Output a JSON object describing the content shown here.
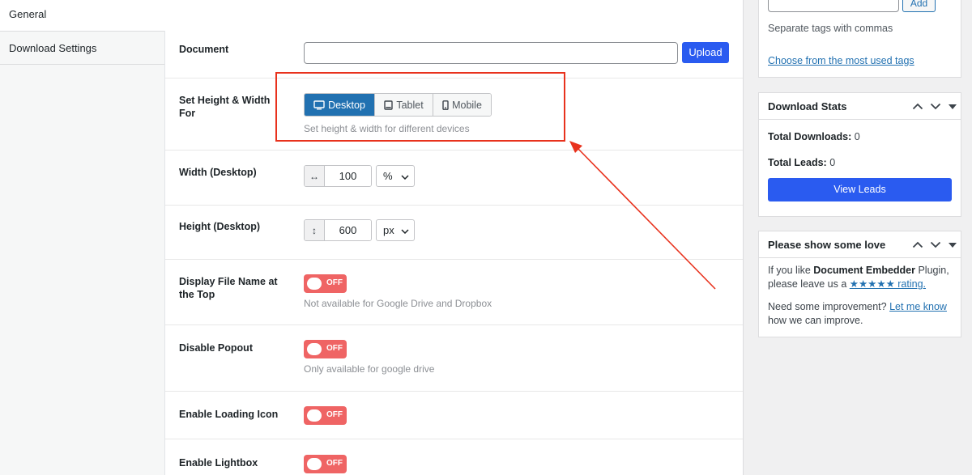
{
  "tabs": [
    {
      "label": "General"
    },
    {
      "label": "Download Settings"
    }
  ],
  "fields": {
    "document": {
      "label": "Document",
      "value": "",
      "upload_label": "Upload"
    },
    "devices": {
      "label": "Set Height & Width For",
      "options": [
        "Desktop",
        "Tablet",
        "Mobile"
      ],
      "selected": "Desktop",
      "desc": "Set height & width for different devices"
    },
    "width": {
      "label": "Width (Desktop)",
      "prefix": "↔",
      "value": "100",
      "unit": "%"
    },
    "height": {
      "label": "Height (Desktop)",
      "prefix": "↕",
      "value": "600",
      "unit": "px"
    },
    "display_file_name": {
      "label": "Display File Name at the Top",
      "state": "OFF",
      "desc": "Not available for Google Drive and Dropbox"
    },
    "disable_popout": {
      "label": "Disable Popout",
      "state": "OFF",
      "desc": "Only available for google drive"
    },
    "loading_icon": {
      "label": "Enable Loading Icon",
      "state": "OFF"
    },
    "lightbox": {
      "label": "Enable Lightbox",
      "state": "OFF"
    }
  },
  "tags_box": {
    "add_label": "Add",
    "hint": "Separate tags with commas",
    "link": "Choose from the most used tags"
  },
  "download_stats": {
    "title": "Download Stats",
    "downloads_label": "Total Downloads:",
    "downloads_value": "0",
    "leads_label": "Total Leads:",
    "leads_value": "0",
    "button": "View Leads"
  },
  "love_box": {
    "title": "Please show some love",
    "line1_a": "If you like ",
    "plugin": "Document Embedder",
    "line1_b": " Plugin,",
    "line2_a": "please leave us a ",
    "rating_link": "★★★★★ rating.",
    "line3_a": "Need some improvement? ",
    "improve_link": "Let me know",
    "line4": "how we can improve."
  },
  "colors": {
    "accent": "#2a5bf0",
    "segment_active": "#2171b1",
    "toggle_off": "#ef6464",
    "annotation": "#e8321d"
  }
}
